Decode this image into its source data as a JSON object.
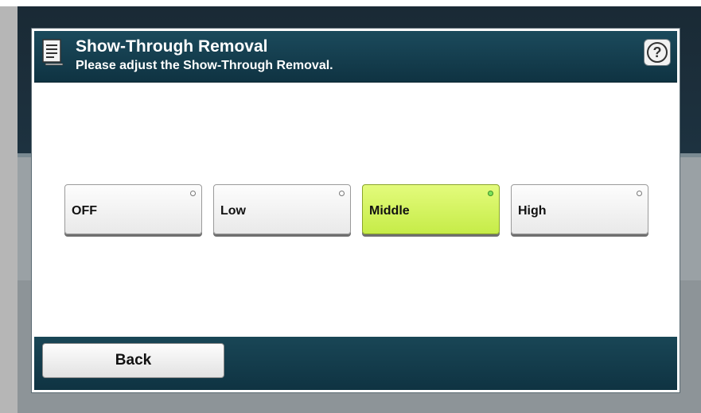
{
  "dialog": {
    "title": "Show-Through Removal",
    "subtitle": "Please adjust the Show-Through Removal.",
    "help_icon": "question-mark-icon",
    "doc_icon": "document-icon"
  },
  "options": [
    {
      "label": "OFF",
      "selected": false
    },
    {
      "label": "Low",
      "selected": false
    },
    {
      "label": "Middle",
      "selected": true
    },
    {
      "label": "High",
      "selected": false
    }
  ],
  "footer": {
    "back_label": "Back"
  },
  "colors": {
    "title_bar": "#0f3342",
    "selected_option": "#c6ec48"
  }
}
